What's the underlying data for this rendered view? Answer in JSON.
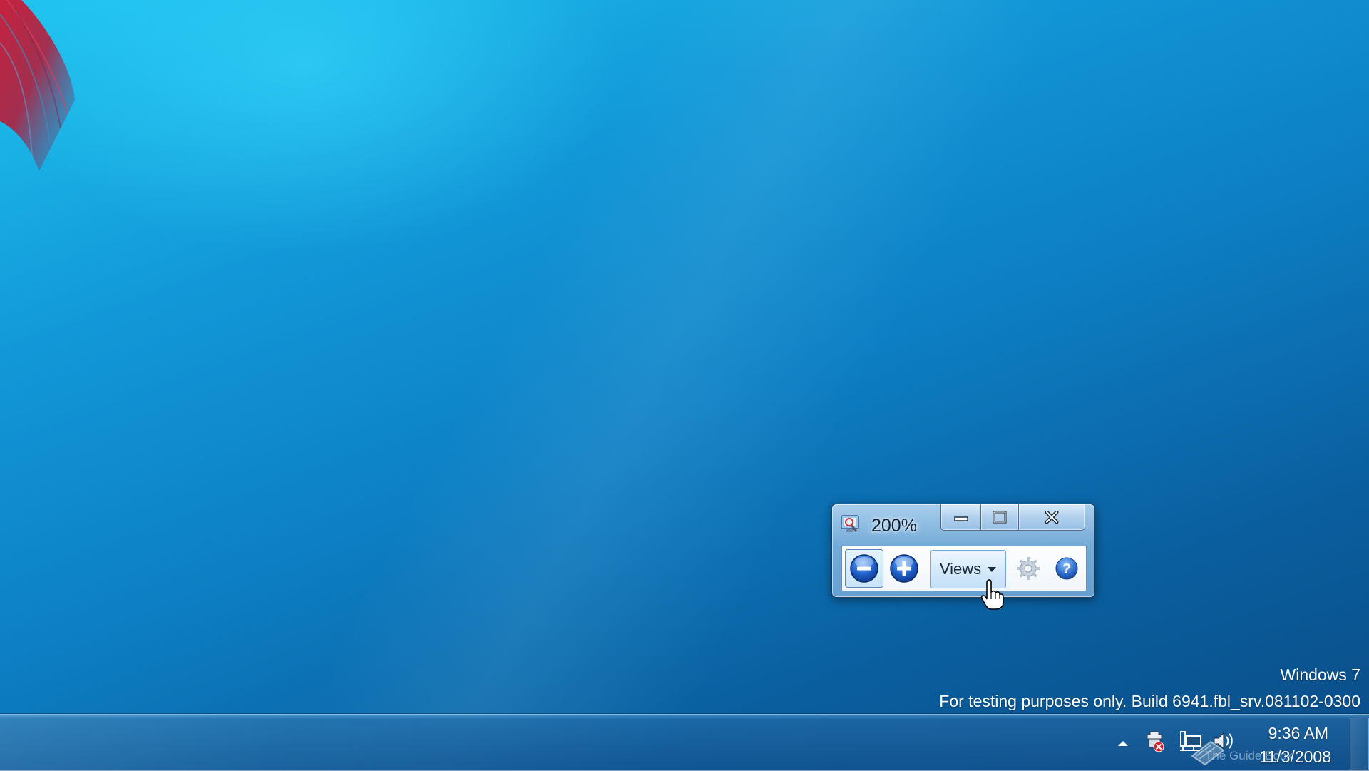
{
  "magnifier": {
    "zoom_level": "200%",
    "toolbar": {
      "zoom_out_icon": "minus-icon",
      "zoom_in_icon": "plus-icon",
      "views_label": "Views",
      "settings_icon": "gear-icon",
      "help_icon": "help-icon"
    },
    "caption": {
      "minimize_icon": "minimize-icon",
      "maximize_icon": "maximize-icon",
      "close_icon": "close-icon"
    }
  },
  "watermark": {
    "line1": "Windows 7",
    "line2": "For testing purposes only. Build 6941.fbl_srv.081102-0300"
  },
  "taskbar": {
    "clock_time": "9:36 AM",
    "clock_date": "11/3/2008",
    "site_watermark": "The Guide Book",
    "tray_icons": [
      "show-hidden-icons-arrow",
      "action-center-icon",
      "network-icon",
      "volume-icon"
    ]
  },
  "colors": {
    "desktop_top": "#1fc4ef",
    "desktop_bottom": "#0a4c86",
    "accent_blue": "#1a63c9"
  }
}
